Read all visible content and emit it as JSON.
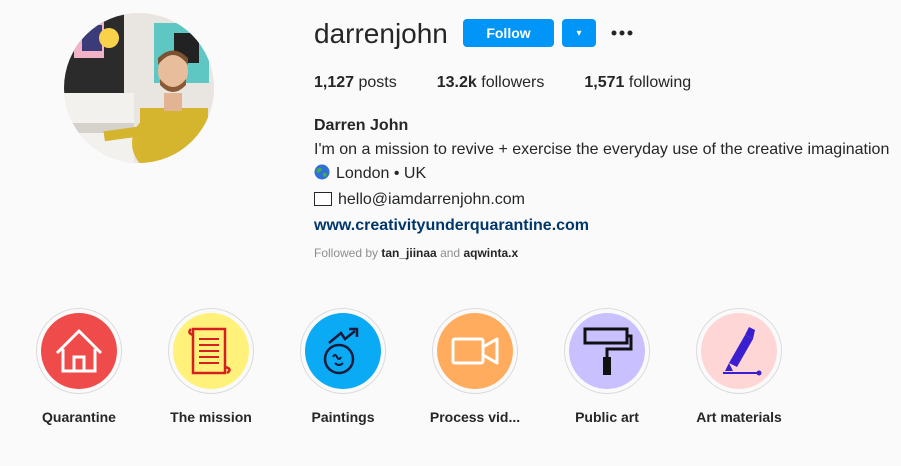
{
  "profile": {
    "username": "darrenjohn",
    "follow_label": "Follow",
    "dropdown_glyph": "▾",
    "stats": {
      "posts_count": "1,127",
      "posts_label": "posts",
      "followers_count": "13.2k",
      "followers_label": "followers",
      "following_count": "1,571",
      "following_label": "following"
    },
    "bio": {
      "full_name": "Darren John",
      "line1": "I'm on a mission to revive + exercise the everyday use of the creative imagination",
      "location": "London • UK",
      "email": "hello@iamdarrenjohn.com",
      "website": "www.creativityunderquarantine.com"
    },
    "followed_by": {
      "prefix": "Followed by",
      "user1": "tan_jiinaa",
      "conjunction": "and",
      "user2": "aqwinta.x"
    }
  },
  "highlights": [
    {
      "label": "Quarantine",
      "icon": "house-icon",
      "color": "#ef4b4b"
    },
    {
      "label": "The mission",
      "icon": "scroll-icon",
      "color": "#fff17a"
    },
    {
      "label": "Paintings",
      "icon": "paint-pot-icon",
      "color": "#0aaaf5"
    },
    {
      "label": "Process vid...",
      "icon": "video-camera-icon",
      "color": "#ffac5e"
    },
    {
      "label": "Public art",
      "icon": "paint-roller-icon",
      "color": "#c9c0ff"
    },
    {
      "label": "Art materials",
      "icon": "paint-tube-icon",
      "color": "#ffd6d6"
    }
  ],
  "colors": {
    "accent": "#0095f6",
    "link": "#00376b",
    "muted": "#8e8e8e"
  }
}
